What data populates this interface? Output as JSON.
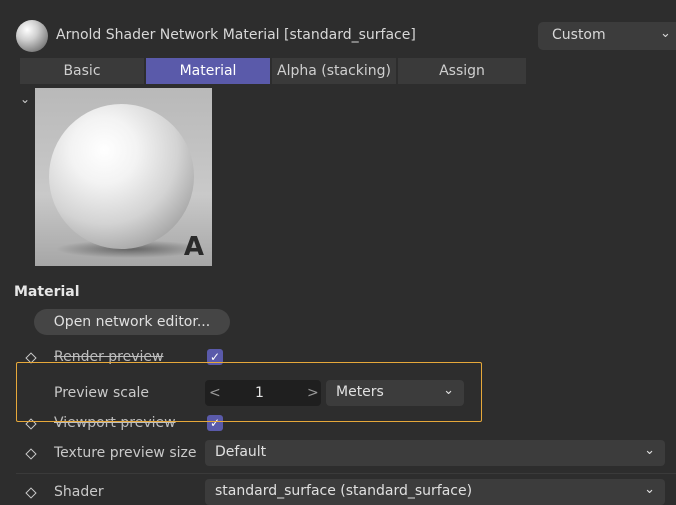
{
  "header": {
    "title": "Arnold Shader Network Material [standard_surface]",
    "preset_value": "Custom"
  },
  "tabs": [
    "Basic",
    "Material",
    "Alpha (stacking)",
    "Assign"
  ],
  "active_tab": "Material",
  "preview": {
    "badge": "A"
  },
  "section_title": "Material",
  "open_editor_label": "Open network editor...",
  "rows": {
    "render_preview": {
      "label": "Render preview",
      "checked": true
    },
    "preview_scale": {
      "label": "Preview scale",
      "value": "1",
      "unit": "Meters"
    },
    "viewport_preview": {
      "label": "Viewport preview",
      "checked": true
    },
    "texture_preview_size": {
      "label": "Texture preview size",
      "value": "Default"
    },
    "shader": {
      "label": "Shader",
      "value": "standard_surface (standard_surface)"
    }
  },
  "icons": {
    "check": "✓",
    "chevron_down": "⌄",
    "arrow_left": "<",
    "arrow_right": ">"
  },
  "colors": {
    "accent": "#5a5aaa",
    "highlight": "#e6a83a",
    "background": "#2d2d2d"
  }
}
